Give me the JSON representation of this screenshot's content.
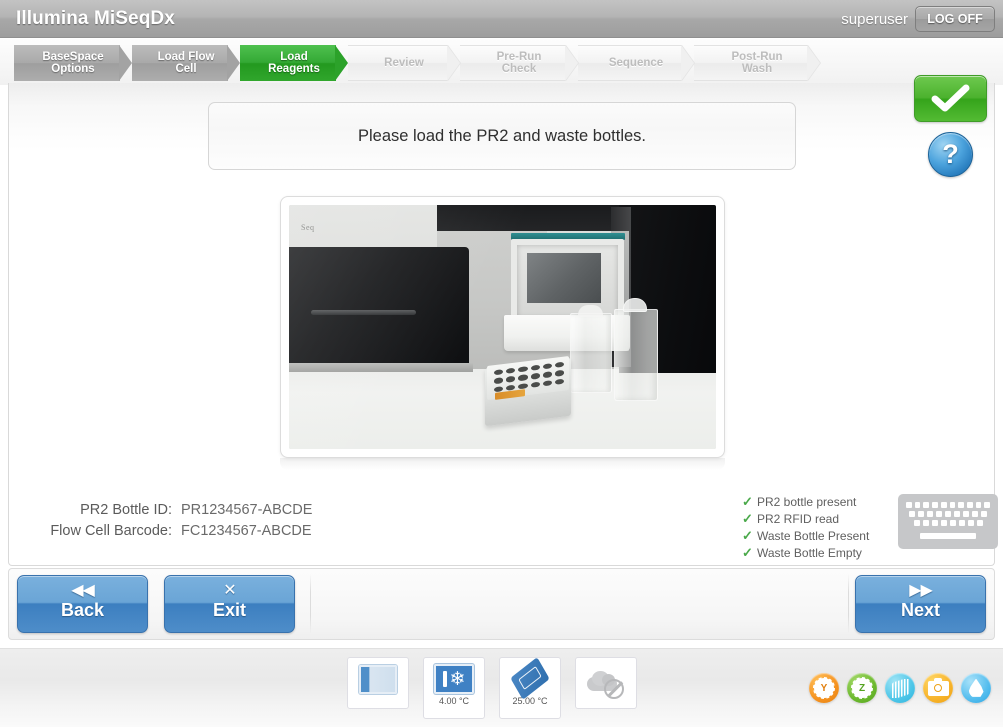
{
  "header": {
    "app_title": "Illumina MiSeqDx",
    "user": "superuser",
    "logoff_label": "LOG OFF"
  },
  "breadcrumb": {
    "steps": [
      {
        "label": "BaseSpace\nOptions",
        "line1": "BaseSpace",
        "line2": "Options",
        "state": "done"
      },
      {
        "label": "Load Flow Cell",
        "line1": "Load Flow",
        "line2": "Cell",
        "state": "done"
      },
      {
        "label": "Load Reagents",
        "line1": "Load",
        "line2": "Reagents",
        "state": "active"
      },
      {
        "label": "Review",
        "line1": "Review",
        "line2": "",
        "state": "next"
      },
      {
        "label": "Pre-Run Check",
        "line1": "Pre-Run",
        "line2": "Check",
        "state": "next"
      },
      {
        "label": "Sequence",
        "line1": "Sequence",
        "line2": "",
        "state": "next"
      },
      {
        "label": "Post-Run Wash",
        "line1": "Post-Run",
        "line2": "Wash",
        "state": "next"
      }
    ]
  },
  "main": {
    "message": "Please load the PR2 and waste bottles.",
    "ok_icon": "checkmark-icon",
    "help_icon": "question-mark-icon",
    "photo_caption": "MiSeq instrument reagent compartment with PR2 and waste bottles",
    "photo_logo": "Seq"
  },
  "info": {
    "rows": [
      {
        "label": "PR2 Bottle ID:",
        "value": "PR1234567-ABCDE"
      },
      {
        "label": "Flow Cell Barcode:",
        "value": "FC1234567-ABCDE"
      }
    ]
  },
  "checks": {
    "mark": "✓",
    "items": [
      "PR2 bottle present",
      "PR2 RFID read",
      "Waste Bottle Present",
      "Waste Bottle Empty"
    ]
  },
  "keyboard_icon": "keyboard-icon",
  "buttons": {
    "back": {
      "icon": "◀◀",
      "label": "Back"
    },
    "exit": {
      "icon": "✕",
      "label": "Exit"
    },
    "next": {
      "icon": "▶▶",
      "label": "Next"
    }
  },
  "status_bar": {
    "sensors": [
      {
        "name": "flow-cell-bay",
        "temp": ""
      },
      {
        "name": "chiller",
        "temp": "4.00 °C"
      },
      {
        "name": "flow-cell-temp",
        "temp": "25.00 °C"
      },
      {
        "name": "cloud-disconnected",
        "temp": ""
      }
    ],
    "round_icons": [
      {
        "name": "gear-y-icon",
        "glyph": "Y",
        "color": "#f59220"
      },
      {
        "name": "gear-z-icon",
        "glyph": "Z",
        "color": "#6cb92e"
      },
      {
        "name": "flow-cell-icon",
        "glyph": "",
        "color": "#4ec6e8"
      },
      {
        "name": "camera-icon",
        "glyph": "",
        "color": "#f7b32a"
      },
      {
        "name": "fluidics-drop-icon",
        "glyph": "",
        "color": "#54bdee"
      }
    ]
  },
  "colors": {
    "active_green": "#2ca22a",
    "button_blue": "#3c7fc0",
    "check_green": "#4aa94a",
    "header_grey": "#a8a8a8"
  }
}
